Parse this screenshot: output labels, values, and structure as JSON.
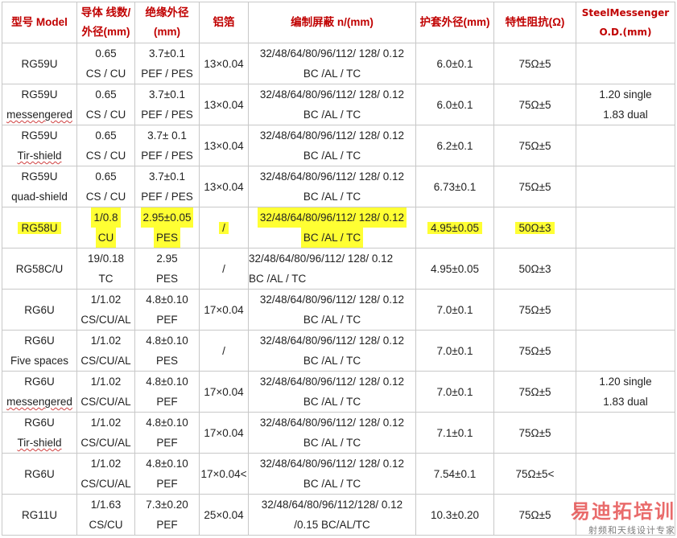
{
  "headers": [
    {
      "l1": "型号 Model",
      "l2": ""
    },
    {
      "l1": "导体 线数/",
      "l2": "外径(mm)"
    },
    {
      "l1": "绝缘外径",
      "l2": "(mm)"
    },
    {
      "l1": "铝箔",
      "l2": ""
    },
    {
      "l1": "编制屏蔽 n/(mm)",
      "l2": ""
    },
    {
      "l1": "护套外径(mm)",
      "l2": ""
    },
    {
      "l1": "特性阻抗(Ω)",
      "l2": ""
    },
    {
      "l1": "SteelMessenger",
      "l2": "O.D.(mm)"
    }
  ],
  "rows": [
    {
      "model": [
        "RG59U",
        ""
      ],
      "conductor": [
        "0.65",
        "CS / CU"
      ],
      "insulation": [
        "3.7±0.1",
        "PEF / PES"
      ],
      "foil": "13×0.04",
      "braid": [
        "32/48/64/80/96/112/ 128/ 0.12",
        "BC /AL / TC"
      ],
      "jacket": "6.0±0.1",
      "impedance": "75Ω±5",
      "messenger": [
        "",
        ""
      ]
    },
    {
      "model": [
        "RG59U",
        "messengered"
      ],
      "conductor": [
        "0.65",
        "CS / CU"
      ],
      "insulation": [
        "3.7±0.1",
        "PEF / PES"
      ],
      "foil": "13×0.04",
      "braid": [
        "32/48/64/80/96/112/ 128/ 0.12",
        "BC /AL / TC"
      ],
      "jacket": "6.0±0.1",
      "impedance": "75Ω±5",
      "messenger": [
        "1.20 single",
        "1.83 dual"
      ]
    },
    {
      "model": [
        "RG59U",
        "Tir-shield"
      ],
      "conductor": [
        "0.65",
        "CS / CU"
      ],
      "insulation": [
        "3.7± 0.1",
        "PEF / PES"
      ],
      "foil": "13×0.04",
      "braid": [
        "32/48/64/80/96/112/ 128/ 0.12",
        "BC /AL / TC"
      ],
      "jacket": "6.2±0.1",
      "impedance": "75Ω±5",
      "messenger": [
        "",
        ""
      ]
    },
    {
      "model": [
        "RG59U",
        "quad-shield"
      ],
      "conductor": [
        "0.65",
        "CS / CU"
      ],
      "insulation": [
        "3.7±0.1",
        "PEF / PES"
      ],
      "foil": "13×0.04",
      "braid": [
        "32/48/64/80/96/112/ 128/ 0.12",
        "BC /AL / TC"
      ],
      "jacket": "6.73±0.1",
      "impedance": "75Ω±5",
      "messenger": [
        "",
        ""
      ]
    },
    {
      "model": [
        "RG58U",
        ""
      ],
      "conductor": [
        "1/0.8",
        "CU"
      ],
      "insulation": [
        "2.95±0.05",
        "PES"
      ],
      "foil": "/",
      "braid": [
        "32/48/64/80/96/112/ 128/ 0.12",
        "BC /AL / TC"
      ],
      "jacket": "4.95±0.05",
      "impedance": "50Ω±3",
      "messenger": [
        "",
        ""
      ]
    },
    {
      "model": [
        "RG58C/U",
        ""
      ],
      "conductor": [
        "19/0.18",
        "TC"
      ],
      "insulation": [
        "2.95",
        "PES"
      ],
      "foil": "/",
      "braid": [
        "32/48/64/80/96/112/ 128/ 0.12",
        "BC /AL / TC"
      ],
      "jacket": "4.95±0.05",
      "impedance": "50Ω±3",
      "messenger": [
        "",
        ""
      ]
    },
    {
      "model": [
        "RG6U",
        ""
      ],
      "conductor": [
        "1/1.02",
        "CS/CU/AL"
      ],
      "insulation": [
        "4.8±0.10",
        "PEF"
      ],
      "foil": "17×0.04",
      "braid": [
        "32/48/64/80/96/112/ 128/ 0.12",
        "BC /AL / TC"
      ],
      "jacket": "7.0±0.1",
      "impedance": "75Ω±5",
      "messenger": [
        "",
        ""
      ]
    },
    {
      "model": [
        "RG6U",
        "Five spaces"
      ],
      "conductor": [
        "1/1.02",
        "CS/CU/AL"
      ],
      "insulation": [
        "4.8±0.10",
        "PES"
      ],
      "foil": "/",
      "braid": [
        "32/48/64/80/96/112/ 128/ 0.12",
        "BC /AL / TC"
      ],
      "jacket": "7.0±0.1",
      "impedance": "75Ω±5",
      "messenger": [
        "",
        ""
      ]
    },
    {
      "model": [
        "RG6U",
        "messengered"
      ],
      "conductor": [
        "1/1.02",
        "CS/CU/AL"
      ],
      "insulation": [
        "4.8±0.10",
        "PEF"
      ],
      "foil": "17×0.04",
      "braid": [
        "32/48/64/80/96/112/ 128/ 0.12",
        "BC /AL / TC"
      ],
      "jacket": "7.0±0.1",
      "impedance": "75Ω±5",
      "messenger": [
        "1.20 single",
        "1.83 dual"
      ]
    },
    {
      "model": [
        "RG6U",
        "Tir-shield"
      ],
      "conductor": [
        "1/1.02",
        "CS/CU/AL"
      ],
      "insulation": [
        "4.8±0.10",
        "PEF"
      ],
      "foil": "17×0.04",
      "braid": [
        "32/48/64/80/96/112/ 128/ 0.12",
        "BC /AL / TC"
      ],
      "jacket": "7.1±0.1",
      "impedance": "75Ω±5",
      "messenger": [
        "",
        ""
      ]
    },
    {
      "model": [
        "RG6U",
        ""
      ],
      "conductor": [
        "1/1.02",
        "CS/CU/AL"
      ],
      "insulation": [
        "4.8±0.10",
        "PEF"
      ],
      "foil": "17×0.04<",
      "braid": [
        "32/48/64/80/96/112/ 128/ 0.12",
        "BC /AL / TC"
      ],
      "jacket": "7.54±0.1",
      "impedance": "75Ω±5<",
      "messenger": [
        "",
        ""
      ]
    },
    {
      "model": [
        "RG11U",
        ""
      ],
      "conductor": [
        "1/1.63",
        "CS/CU"
      ],
      "insulation": [
        "7.3±0.20",
        "PEF"
      ],
      "foil": "25×0.04",
      "braid": [
        "32/48/64/80/96/112/128/ 0.12",
        "/0.15 BC/AL/TC"
      ],
      "jacket": "10.3±0.20",
      "impedance": "75Ω±5",
      "messenger": [
        "",
        ""
      ]
    }
  ],
  "watermark": {
    "line1": "易迪拓培训",
    "line2": "射频和天线设计专家"
  },
  "colors": {
    "header_text": "#c00000",
    "highlight": "#ffff33",
    "border": "#c8c8c8",
    "watermark": "#e23a3a"
  }
}
